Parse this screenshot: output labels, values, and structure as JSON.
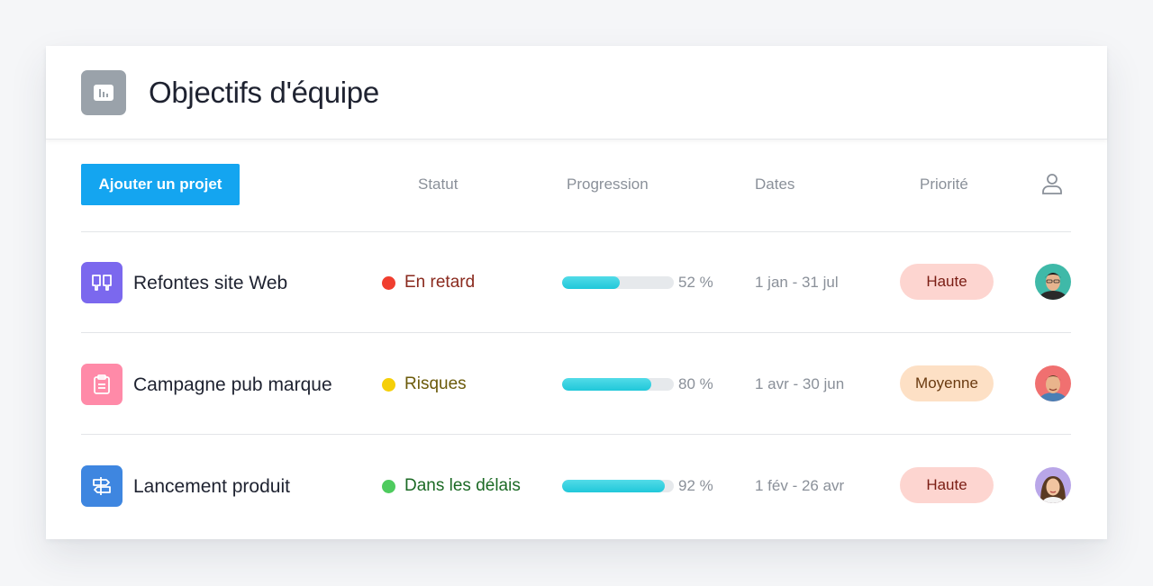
{
  "header": {
    "title": "Objectifs d'équipe",
    "icon": "bar-chart-icon"
  },
  "toolbar": {
    "add_label": "Ajouter un projet"
  },
  "columns": {
    "status": "Statut",
    "progress": "Progression",
    "dates": "Dates",
    "priority": "Priorité",
    "assignee_icon": "user-icon"
  },
  "projects": [
    {
      "name": "Refontes site Web",
      "icon": "book-icon",
      "icon_color": "#7b68ee",
      "status": "En retard",
      "status_color": "#f03e2f",
      "status_text_color": "#8a2a1e",
      "progress": 52,
      "progress_label": "52 %",
      "dates": "1 jan - 31 jul",
      "priority": "Haute",
      "priority_bg": "#fdd5d0",
      "priority_color": "#7a1d14",
      "avatar": "avatar-man-glasses"
    },
    {
      "name": "Campagne pub marque",
      "icon": "clipboard-icon",
      "icon_color": "#ff8aa8",
      "status": "Risques",
      "status_color": "#f5cf08",
      "status_text_color": "#6b5a0a",
      "progress": 80,
      "progress_label": "80 %",
      "dates": "1 avr - 30 jun",
      "priority": "Moyenne",
      "priority_bg": "#fde0c5",
      "priority_color": "#6a3a10",
      "avatar": "avatar-man-smiling"
    },
    {
      "name": "Lancement produit",
      "icon": "signpost-icon",
      "icon_color": "#3e86e0",
      "status": "Dans les délais",
      "status_color": "#4ecb5e",
      "status_text_color": "#1c6a25",
      "progress": 92,
      "progress_label": "92 %",
      "dates": "1 fév - 26 avr",
      "priority": "Haute",
      "priority_bg": "#fdd5d0",
      "priority_color": "#7a1d14",
      "avatar": "avatar-woman"
    }
  ]
}
